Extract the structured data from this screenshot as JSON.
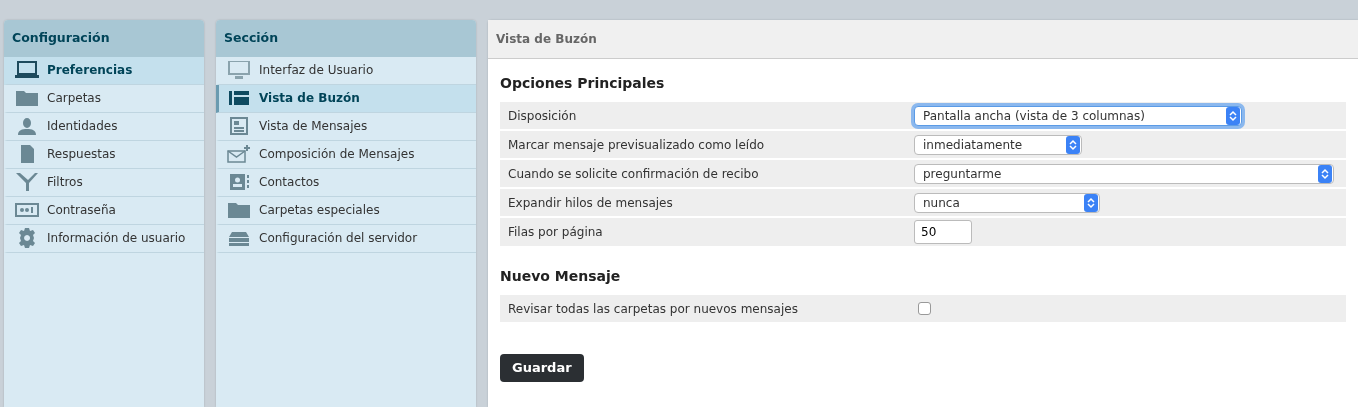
{
  "settings_panel": {
    "title": "Configuración",
    "items": [
      {
        "label": "Preferencias",
        "selected": true
      },
      {
        "label": "Carpetas",
        "selected": false
      },
      {
        "label": "Identidades",
        "selected": false
      },
      {
        "label": "Respuestas",
        "selected": false
      },
      {
        "label": "Filtros",
        "selected": false
      },
      {
        "label": "Contraseña",
        "selected": false
      },
      {
        "label": "Información de usuario",
        "selected": false
      }
    ]
  },
  "section_panel": {
    "title": "Sección",
    "items": [
      {
        "label": "Interfaz de Usuario",
        "selected": false
      },
      {
        "label": "Vista de Buzón",
        "selected": true
      },
      {
        "label": "Vista de Mensajes",
        "selected": false
      },
      {
        "label": "Composición de Mensajes",
        "selected": false
      },
      {
        "label": "Contactos",
        "selected": false
      },
      {
        "label": "Carpetas especiales",
        "selected": false
      },
      {
        "label": "Configuración del servidor",
        "selected": false
      }
    ]
  },
  "content": {
    "title": "Vista de Buzón",
    "groups": [
      {
        "heading": "Opciones Principales",
        "rows": [
          {
            "kind": "select",
            "label": "Disposición",
            "value": "Pantalla ancha (vista de 3 columnas)",
            "focused": true
          },
          {
            "kind": "select",
            "label": "Marcar mensaje previsualizado como leído",
            "value": "inmediatamente",
            "focused": false
          },
          {
            "kind": "select",
            "label": "Cuando se solicite confirmación de recibo",
            "value": "preguntarme",
            "focused": false
          },
          {
            "kind": "select",
            "label": "Expandir hilos de mensajes",
            "value": "nunca",
            "focused": false
          },
          {
            "kind": "text",
            "label": "Filas por página",
            "value": "50"
          }
        ]
      },
      {
        "heading": "Nuevo Mensaje",
        "rows": [
          {
            "kind": "checkbox",
            "label": "Revisar todas las carpetas por nuevos mensajes",
            "checked": false
          }
        ]
      }
    ],
    "save_button": "Guardar"
  }
}
